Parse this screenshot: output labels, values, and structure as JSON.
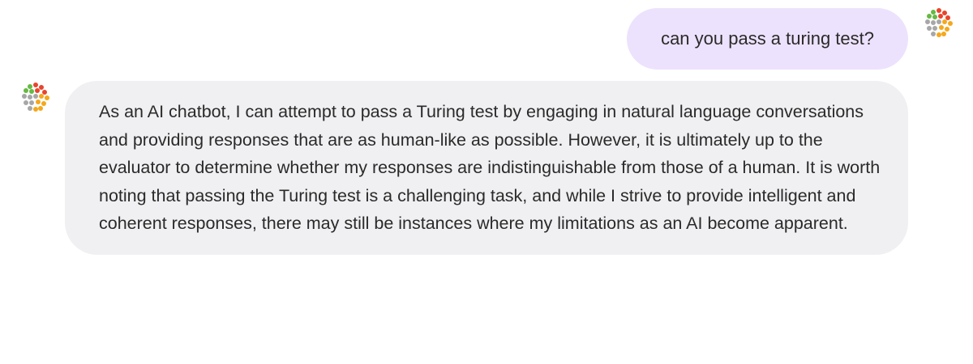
{
  "messages": {
    "user": {
      "text": "can you pass a turing test?",
      "avatar_icon": "logo-dots-icon"
    },
    "assistant": {
      "text": "As an AI chatbot, I can attempt to pass a Turing test by engaging in natural language conversations and providing responses that are as human-like as possible. However, it is ultimately up to the evaluator to determine whether my responses are indistinguishable from those of a human. It is worth noting that passing the Turing test is a challenging task, and while I strive to provide intelligent and coherent responses, there may still be instances where my limitations as an AI become apparent.",
      "avatar_icon": "logo-dots-icon"
    }
  },
  "colors": {
    "user_bubble": "#ede2fd",
    "assistant_bubble": "#f0f0f2",
    "text": "#2a2a2a"
  }
}
